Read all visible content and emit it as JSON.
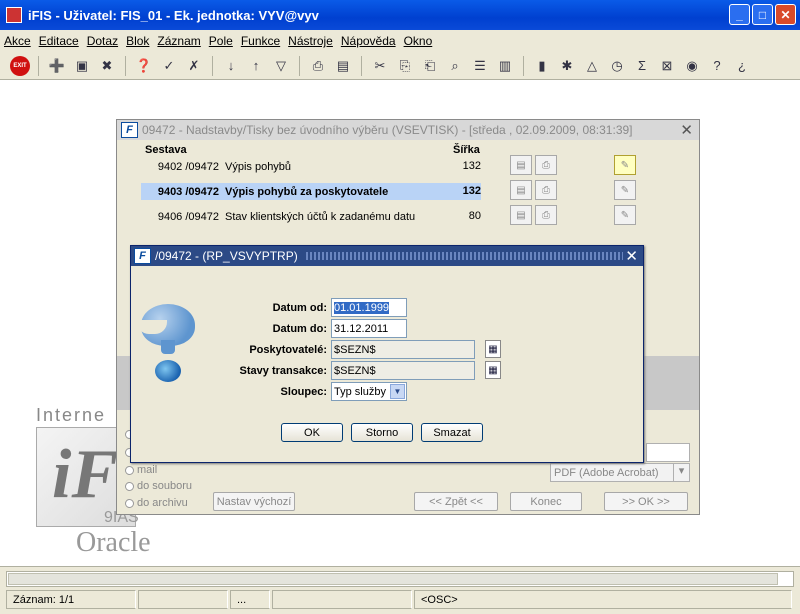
{
  "app": {
    "title": "iFIS - Uživatel: FIS_01 - Ek. jednotka: VYV@vyv",
    "win_min": "_",
    "win_max": "□",
    "win_close": "✕"
  },
  "menu": [
    "Akce",
    "Editace",
    "Dotaz",
    "Blok",
    "Záznam",
    "Pole",
    "Funkce",
    "Nástroje",
    "Nápověda",
    "Okno"
  ],
  "toolbar": {
    "exit_label": "EXIT"
  },
  "background": {
    "logo_top": "Interne",
    "logo_mid": "iF",
    "logo_small": "9IAS",
    "logo_bottom": "Oracle"
  },
  "report_window": {
    "title": "09472 - Nadstavby/Tisky bez úvodního výběru (VSEVTISK) - [středa , 02.09.2009, 08:31:39]",
    "close": "✕",
    "col_sestava": "Sestava",
    "col_sirka": "Šířka",
    "rows": [
      {
        "id": "9402 /09472",
        "name": "Výpis pohybů",
        "width": "132",
        "selected": false
      },
      {
        "id": "9403 /09472",
        "name": "Výpis pohybů za poskytovatele",
        "width": "132",
        "selected": true
      },
      {
        "id": "9406 /09472",
        "name": "Stav klientských účtů k zadanému datu",
        "width": "80",
        "selected": false
      }
    ],
    "output_options": [
      "",
      "",
      "mail",
      "do souboru",
      "do archivu"
    ],
    "btn_reset": "Nastav výchozí",
    "format_value": "PDF (Adobe Acrobat)",
    "btn_back": "<< Zpět <<",
    "btn_end": "Konec",
    "btn_ok": ">> OK >>"
  },
  "param_dialog": {
    "title": "/09472 - (RP_VSVYPTRP)",
    "close": "✕",
    "fields": {
      "datum_od_label": "Datum od:",
      "datum_od_value": "01.01.1999",
      "datum_do_label": "Datum do:",
      "datum_do_value": "31.12.2011",
      "poskytovatele_label": "Poskytovatelé:",
      "poskytovatele_value": "$SEZN$",
      "stavy_label": "Stavy transakce:",
      "stavy_value": "$SEZN$",
      "sloupec_label": "Sloupec:",
      "sloupec_value": "Typ služby"
    },
    "btn_ok": "OK",
    "btn_storno": "Storno",
    "btn_smazat": "Smazat"
  },
  "status": {
    "record": "Záznam: 1/1",
    "cell2": "",
    "cell3": "...",
    "cell4": "",
    "osc": "<OSC>"
  }
}
